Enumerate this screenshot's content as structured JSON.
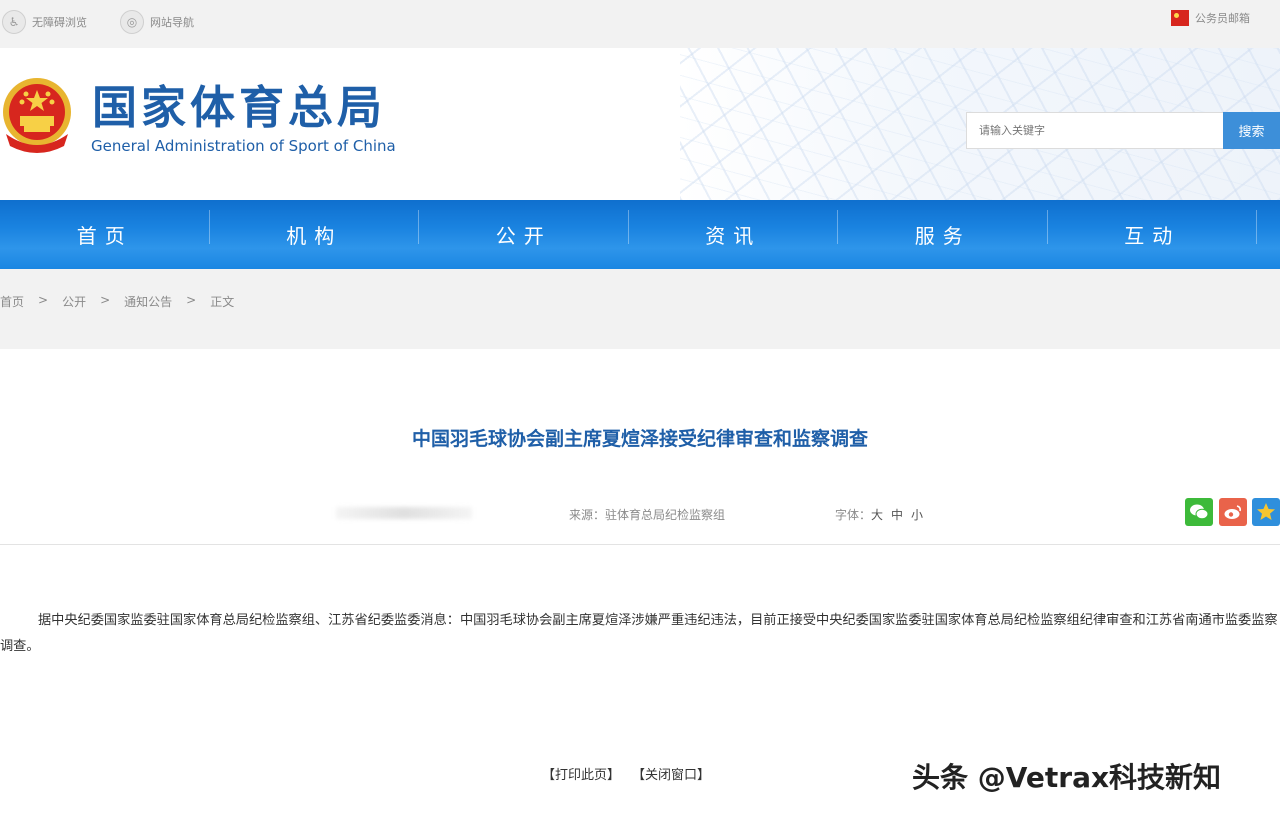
{
  "topbar": {
    "accessibility": "无障碍浏览",
    "site_nav": "网站导航",
    "mail": "公务员邮箱"
  },
  "header": {
    "logo_cn": "国家体育总局",
    "logo_en": "General Administration of Sport of China",
    "search_placeholder": "请输入关键字",
    "search_button": "搜索"
  },
  "nav": {
    "items": [
      "首页",
      "机构",
      "公开",
      "资讯",
      "服务",
      "互动"
    ]
  },
  "breadcrumb": {
    "items": [
      "首页",
      ">",
      "公开",
      ">",
      "通知公告",
      ">",
      "正文"
    ]
  },
  "article": {
    "title": "中国羽毛球协会副主席夏煊泽接受纪律审查和监察调查",
    "source": "来源：驻体育总局纪检监察组",
    "font_label": "字体：",
    "font_large": "大",
    "font_medium": "中",
    "font_small": "小",
    "body": "据中央纪委国家监委驻国家体育总局纪检监察组、江苏省纪委监委消息：中国羽毛球协会副主席夏煊泽涉嫌严重违纪违法，目前正接受中央纪委国家监委驻国家体育总局纪检监察组纪律审查和江苏省南通市监委监察调查。"
  },
  "share": {
    "wechat_color": "#3dba3a",
    "weibo_color": "#e9634a",
    "favorite_color": "#2f8fdc"
  },
  "footer": {
    "print": "【打印此页】",
    "close": "【关闭窗口】"
  },
  "watermark": "头条 @Vetrax科技新知"
}
